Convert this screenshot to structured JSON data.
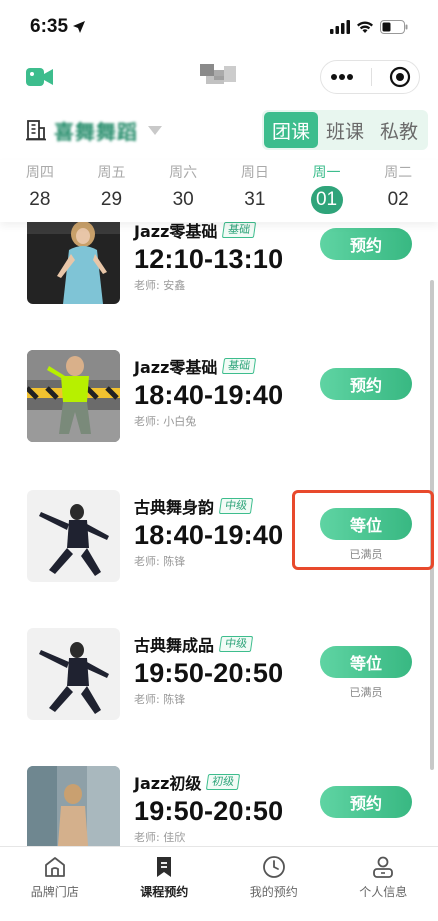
{
  "status": {
    "time": "6:35"
  },
  "store": {
    "name": "喜舞舞蹈"
  },
  "segments": [
    {
      "label": "团课",
      "active": true
    },
    {
      "label": "班课",
      "active": false
    },
    {
      "label": "私教",
      "active": false
    }
  ],
  "dates": [
    {
      "weekday": "周四",
      "day": "28",
      "active": false
    },
    {
      "weekday": "周五",
      "day": "29",
      "active": false
    },
    {
      "weekday": "周六",
      "day": "30",
      "active": false
    },
    {
      "weekday": "周日",
      "day": "31",
      "active": false
    },
    {
      "weekday": "周一",
      "day": "01",
      "active": true
    },
    {
      "weekday": "周二",
      "day": "02",
      "active": false
    }
  ],
  "courses": [
    {
      "name": "Jazz零基础",
      "level": "基础",
      "time": "12:10-13:10",
      "teacher": "老师: 安鑫",
      "action": "预约",
      "status": ""
    },
    {
      "name": "Jazz零基础",
      "level": "基础",
      "time": "18:40-19:40",
      "teacher": "老师: 小白兔",
      "action": "预约",
      "status": ""
    },
    {
      "name": "古典舞身韵",
      "level": "中级",
      "time": "18:40-19:40",
      "teacher": "老师: 陈锋",
      "action": "等位",
      "status": "已满员"
    },
    {
      "name": "古典舞成品",
      "level": "中级",
      "time": "19:50-20:50",
      "teacher": "老师: 陈锋",
      "action": "等位",
      "status": "已满员"
    },
    {
      "name": "Jazz初级",
      "level": "初级",
      "time": "19:50-20:50",
      "teacher": "老师: 佳欣",
      "action": "预约",
      "status": ""
    }
  ],
  "tabs": [
    {
      "label": "品牌门店",
      "icon": "home-icon",
      "active": false
    },
    {
      "label": "课程预约",
      "icon": "bookmark-icon",
      "active": true
    },
    {
      "label": "我的预约",
      "icon": "clock-icon",
      "active": false
    },
    {
      "label": "个人信息",
      "icon": "person-icon",
      "active": false
    }
  ],
  "colors": {
    "accent": "#3dbd8d",
    "accent_dark": "#2fa47a",
    "highlight": "#e8492c"
  }
}
